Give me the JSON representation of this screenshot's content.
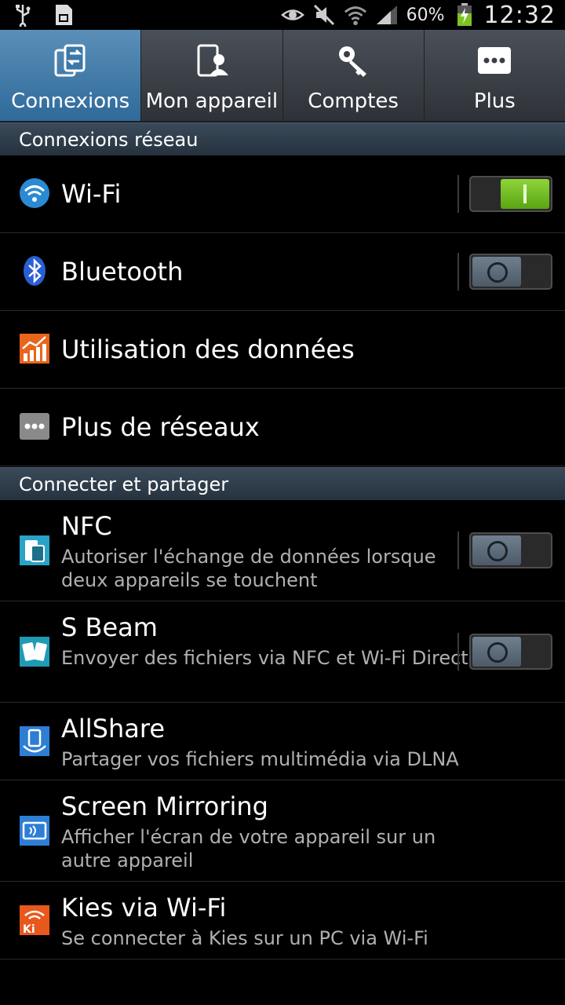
{
  "status_bar": {
    "battery_percent": "60%",
    "time": "12:32",
    "icons": [
      "usb-icon",
      "sd-card-icon",
      "eye-icon",
      "mute-icon",
      "wifi-signal-icon",
      "cell-signal-icon",
      "battery-charging-icon"
    ]
  },
  "tabs": [
    {
      "label": "Connexions",
      "icon": "connections-icon",
      "active": true
    },
    {
      "label": "Mon appareil",
      "icon": "device-icon",
      "active": false
    },
    {
      "label": "Comptes",
      "icon": "key-icon",
      "active": false
    },
    {
      "label": "Plus",
      "icon": "more-icon",
      "active": false
    }
  ],
  "sections": {
    "network": "Connexions réseau",
    "share": "Connecter et partager"
  },
  "network_items": [
    {
      "title": "Wi-Fi",
      "icon": "wifi-icon",
      "toggle": "on"
    },
    {
      "title": "Bluetooth",
      "icon": "bluetooth-icon",
      "toggle": "off"
    },
    {
      "title": "Utilisation des données",
      "icon": "data-usage-icon"
    },
    {
      "title": "Plus de réseaux",
      "icon": "more-networks-icon"
    }
  ],
  "share_items": [
    {
      "title": "NFC",
      "subtitle": "Autoriser l'échange de données lorsque deux appareils se touchent",
      "icon": "nfc-icon",
      "toggle": "off"
    },
    {
      "title": "S Beam",
      "subtitle": "Envoyer des fichiers via NFC et Wi-Fi Direct",
      "icon": "s-beam-icon",
      "toggle": "off"
    },
    {
      "title": "AllShare",
      "subtitle": "Partager vos fichiers multimédia via DLNA",
      "icon": "allshare-icon"
    },
    {
      "title": "Screen Mirroring",
      "subtitle": "Afficher l'écran de votre appareil sur un autre appareil",
      "icon": "screen-mirroring-icon"
    },
    {
      "title": "Kies via Wi-Fi",
      "subtitle": "Se connecter à Kies sur un PC via Wi-Fi",
      "icon": "kies-wifi-icon"
    }
  ],
  "colors": {
    "active_tab": "#3f7fb0",
    "toggle_on": "#7cc424",
    "section_bg": "#2e3a46"
  }
}
